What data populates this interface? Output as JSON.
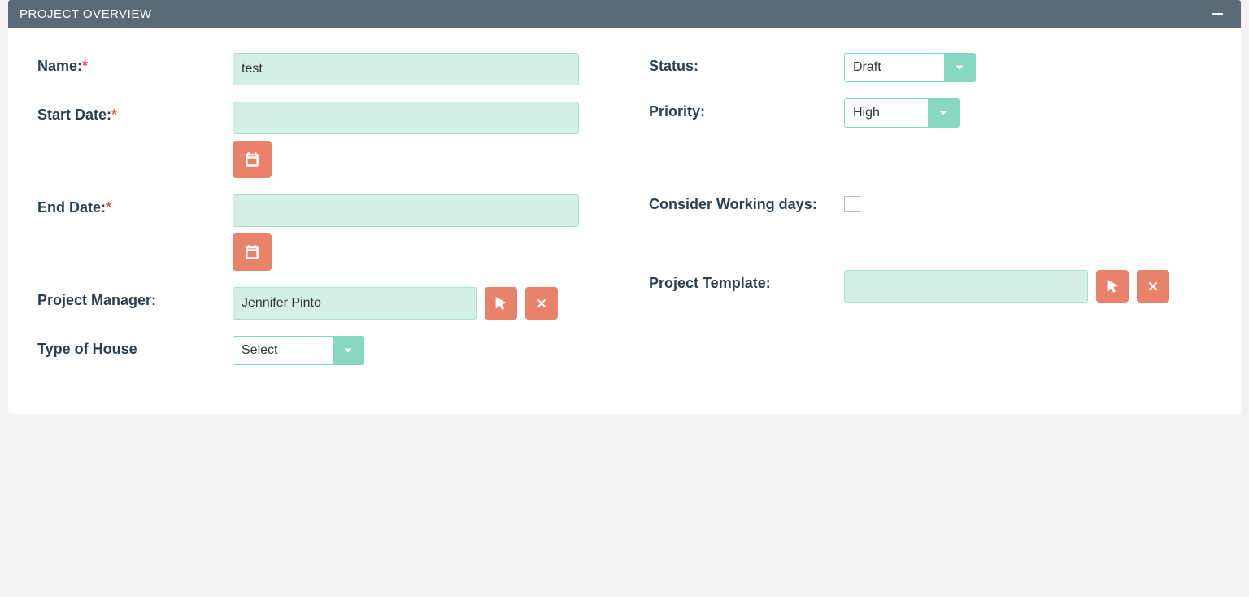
{
  "panel": {
    "title": "PROJECT OVERVIEW"
  },
  "labels": {
    "name": "Name:",
    "start_date": "Start Date:",
    "end_date": "End Date:",
    "project_manager": "Project Manager:",
    "type_of_house": "Type of House",
    "status": "Status:",
    "priority": "Priority:",
    "consider_working_days": "Consider Working days:",
    "project_template": "Project Template:"
  },
  "values": {
    "name": "test",
    "start_date": "",
    "end_date": "",
    "project_manager": "Jennifer Pinto",
    "type_of_house": "Select",
    "status": "Draft",
    "priority": "High",
    "consider_working_days": false,
    "project_template": ""
  },
  "colors": {
    "header_bg": "#5a6a77",
    "accent_mint": "#87d8c3",
    "input_mint": "#d4efe6",
    "btn_coral": "#e9826b",
    "required": "#e25858",
    "label_text": "#2c3e50"
  }
}
